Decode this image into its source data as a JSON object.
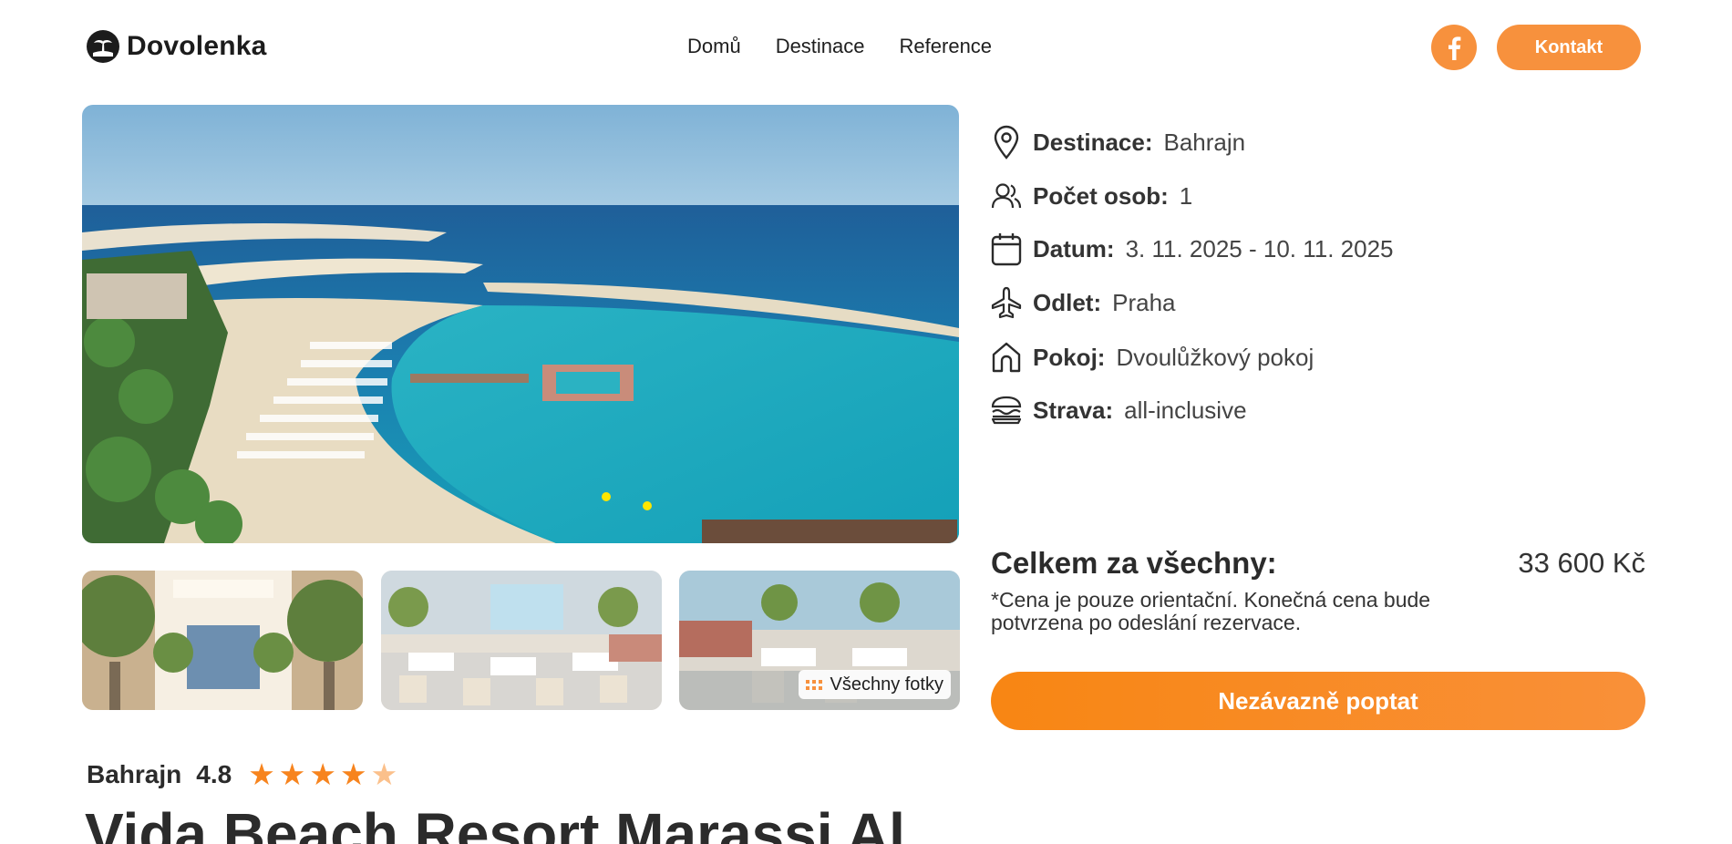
{
  "header": {
    "logo_text": "Dovolenka",
    "nav": [
      {
        "label": "Domů"
      },
      {
        "label": "Destinace"
      },
      {
        "label": "Reference"
      }
    ],
    "facebook_icon": "facebook-icon",
    "contact_label": "Kontakt"
  },
  "gallery": {
    "all_photos_label": "Všechny fotky"
  },
  "details": {
    "destination": {
      "label": "Destinace:",
      "value": "Bahrajn",
      "icon": "location-pin-icon"
    },
    "persons": {
      "label": "Počet osob:",
      "value": "1",
      "icon": "people-icon"
    },
    "date": {
      "label": "Datum:",
      "value": "3. 11. 2025 - 10. 11. 2025",
      "icon": "calendar-icon"
    },
    "departure": {
      "label": "Odlet:",
      "value": "Praha",
      "icon": "plane-icon"
    },
    "room": {
      "label": "Pokoj:",
      "value": "Dvoulůžkový pokoj",
      "icon": "house-icon"
    },
    "board": {
      "label": "Strava:",
      "value": "all-inclusive",
      "icon": "food-icon"
    }
  },
  "pricing": {
    "total_label": "Celkem za všechny:",
    "total_value": "33 600 Kč",
    "note": "*Cena je pouze orientační. Konečná cena bude potvrzena po odeslání rezervace.",
    "cta_label": "Nezávazně poptat"
  },
  "hotel": {
    "destination": "Bahrajn",
    "rating": "4.8",
    "stars_filled": 4,
    "stars_total": 5,
    "name": "Vida Beach Resort Marassi Al"
  },
  "colors": {
    "accent": "#f7913d",
    "star_filled": "#f7841e",
    "star_empty": "#fbc08b",
    "text": "#2b2b2b"
  }
}
